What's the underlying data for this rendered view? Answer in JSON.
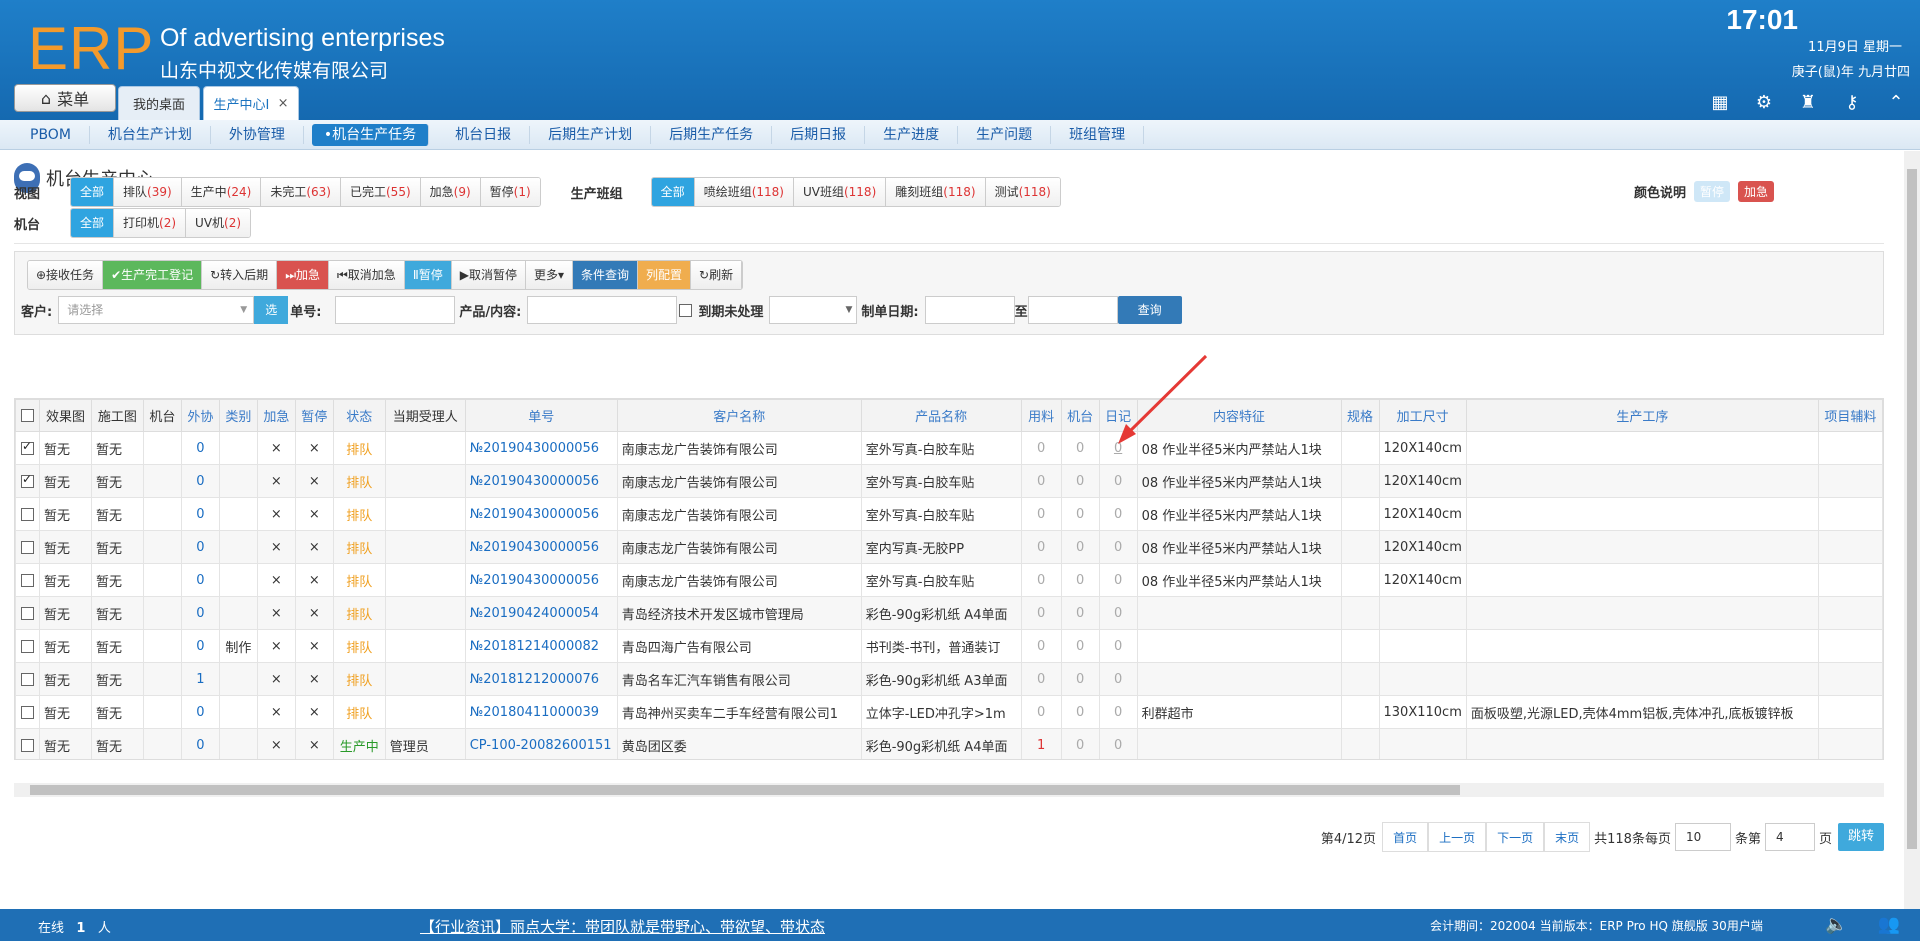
{
  "header": {
    "logo": "ERP",
    "company_en": "Of advertising enterprises",
    "company_cn": "山东中视文化传媒有限公司",
    "time": "17:01",
    "date": "11月9日 星期一",
    "lunar": "庚子(鼠)年 九月廿四",
    "menu_label": "菜单",
    "tabs": [
      {
        "label": "我的桌面"
      },
      {
        "label": "生产中心Ⅰ"
      }
    ],
    "tab_close": "×"
  },
  "subnav": [
    "PBOM",
    "机台生产计划",
    "外协管理",
    "•机台生产任务",
    "机台日报",
    "后期生产计划",
    "后期生产任务",
    "后期日报",
    "生产进度",
    "生产问题",
    "班组管理"
  ],
  "page": {
    "title": "机台生产中心",
    "view_label": "视图",
    "team_label": "生产班组",
    "machine_label": "机台",
    "color_legend_label": "颜色说明",
    "legend_paused": "暂停",
    "legend_urgent": "加急"
  },
  "views": [
    {
      "label": "全部",
      "count": ""
    },
    {
      "label": "排队",
      "count": "(39)"
    },
    {
      "label": "生产中",
      "count": "(24)"
    },
    {
      "label": "未完工",
      "count": "(63)"
    },
    {
      "label": "已完工",
      "count": "(55)"
    },
    {
      "label": "加急",
      "count": "(9)"
    },
    {
      "label": "暂停",
      "count": "(1)"
    }
  ],
  "teams": [
    {
      "label": "全部",
      "count": ""
    },
    {
      "label": "喷绘班组",
      "count": "(118)"
    },
    {
      "label": "UV班组",
      "count": "(118)"
    },
    {
      "label": "雕刻班组",
      "count": "(118)"
    },
    {
      "label": "测试",
      "count": "(118)"
    }
  ],
  "machines": [
    {
      "label": "全部",
      "count": ""
    },
    {
      "label": "打印机",
      "count": "(2)"
    },
    {
      "label": "UV机",
      "count": "(2)"
    }
  ],
  "toolbar": [
    "⊕接收任务",
    "✔生产完工登记",
    "↻转入后期",
    "⏭加急",
    "⏮取消加急",
    "Ⅱ暂停",
    "▶取消暂停",
    "更多▾",
    "条件查询",
    "列配置",
    "↻刷新"
  ],
  "search": {
    "customer_label": "客户:",
    "customer_placeholder": "请选择",
    "select_btn": "选",
    "order_label": "单号:",
    "product_label": "产品/内容:",
    "due_label": "到期未处理",
    "date_label": "制单日期:",
    "to_label": "至",
    "query_btn": "查询"
  },
  "columns": [
    "效果图",
    "施工图",
    "机台",
    "外协",
    "类别",
    "加急",
    "暂停",
    "状态",
    "当期受理人",
    "单号",
    "客户名称",
    "产品名称",
    "用料",
    "机台",
    "日记",
    "内容特征",
    "规格",
    "加工尺寸",
    "生产工序",
    "项目辅料"
  ],
  "rows": [
    {
      "checked": true,
      "effect": "暂无",
      "construct": "暂无",
      "machine": "",
      "outsource": "0",
      "category": "",
      "urgent": "×",
      "paused": "×",
      "status": "排队",
      "assignee": "",
      "order": "№20190430000056",
      "customer": "南康志龙广告装饰有限公司",
      "product": "室外写真-白胶车贴",
      "material": "0",
      "mc": "0",
      "diary": "0",
      "feature": "08 作业半径5米内严禁站人1块",
      "spec": "",
      "size": "120X140cm",
      "process": "",
      "aux": ""
    },
    {
      "checked": true,
      "effect": "暂无",
      "construct": "暂无",
      "machine": "",
      "outsource": "0",
      "category": "",
      "urgent": "×",
      "paused": "×",
      "status": "排队",
      "assignee": "",
      "order": "№20190430000056",
      "customer": "南康志龙广告装饰有限公司",
      "product": "室外写真-白胶车贴",
      "material": "0",
      "mc": "0",
      "diary": "0",
      "feature": "08 作业半径5米内严禁站人1块",
      "spec": "",
      "size": "120X140cm",
      "process": "",
      "aux": ""
    },
    {
      "checked": false,
      "effect": "暂无",
      "construct": "暂无",
      "machine": "",
      "outsource": "0",
      "category": "",
      "urgent": "×",
      "paused": "×",
      "status": "排队",
      "assignee": "",
      "order": "№20190430000056",
      "customer": "南康志龙广告装饰有限公司",
      "product": "室外写真-白胶车贴",
      "material": "0",
      "mc": "0",
      "diary": "0",
      "feature": "08 作业半径5米内严禁站人1块",
      "spec": "",
      "size": "120X140cm",
      "process": "",
      "aux": ""
    },
    {
      "checked": false,
      "effect": "暂无",
      "construct": "暂无",
      "machine": "",
      "outsource": "0",
      "category": "",
      "urgent": "×",
      "paused": "×",
      "status": "排队",
      "assignee": "",
      "order": "№20190430000056",
      "customer": "南康志龙广告装饰有限公司",
      "product": "室内写真-无胶PP",
      "material": "0",
      "mc": "0",
      "diary": "0",
      "feature": "08 作业半径5米内严禁站人1块",
      "spec": "",
      "size": "120X140cm",
      "process": "",
      "aux": ""
    },
    {
      "checked": false,
      "effect": "暂无",
      "construct": "暂无",
      "machine": "",
      "outsource": "0",
      "category": "",
      "urgent": "×",
      "paused": "×",
      "status": "排队",
      "assignee": "",
      "order": "№20190430000056",
      "customer": "南康志龙广告装饰有限公司",
      "product": "室外写真-白胶车贴",
      "material": "0",
      "mc": "0",
      "diary": "0",
      "feature": "08 作业半径5米内严禁站人1块",
      "spec": "",
      "size": "120X140cm",
      "process": "",
      "aux": ""
    },
    {
      "checked": false,
      "effect": "暂无",
      "construct": "暂无",
      "machine": "",
      "outsource": "0",
      "category": "",
      "urgent": "×",
      "paused": "×",
      "status": "排队",
      "assignee": "",
      "order": "№20190424000054",
      "customer": "青岛经济技术开发区城市管理局",
      "product": "彩色-90g彩机纸 A4单面",
      "material": "0",
      "mc": "0",
      "diary": "0",
      "feature": "",
      "spec": "",
      "size": "",
      "process": "",
      "aux": ""
    },
    {
      "checked": false,
      "effect": "暂无",
      "construct": "暂无",
      "machine": "",
      "outsource": "0",
      "category": "制作",
      "urgent": "×",
      "paused": "×",
      "status": "排队",
      "assignee": "",
      "order": "№20181214000082",
      "customer": "青岛四海广告有限公司",
      "product": "书刊类-书刊，普通装订",
      "material": "0",
      "mc": "0",
      "diary": "0",
      "feature": "",
      "spec": "",
      "size": "",
      "process": "",
      "aux": ""
    },
    {
      "checked": false,
      "effect": "暂无",
      "construct": "暂无",
      "machine": "",
      "outsource": "1",
      "category": "",
      "urgent": "×",
      "paused": "×",
      "status": "排队",
      "assignee": "",
      "order": "№20181212000076",
      "customer": "青岛名车汇汽车销售有限公司",
      "product": "彩色-90g彩机纸 A3单面",
      "material": "0",
      "mc": "0",
      "diary": "0",
      "feature": "",
      "spec": "",
      "size": "",
      "process": "",
      "aux": ""
    },
    {
      "checked": false,
      "effect": "暂无",
      "construct": "暂无",
      "machine": "",
      "outsource": "0",
      "category": "",
      "urgent": "×",
      "paused": "×",
      "status": "排队",
      "assignee": "",
      "order": "№20180411000039",
      "customer": "青岛神州买卖车二手车经营有限公司1",
      "product": "立体字-LED冲孔字>1m",
      "material": "0",
      "mc": "0",
      "diary": "0",
      "feature": "利群超市",
      "spec": "",
      "size": "130X110cm",
      "process": "面板吸塑,光源LED,壳体4mm铝板,壳体冲孔,底板镀锌板",
      "aux": ""
    },
    {
      "checked": false,
      "effect": "暂无",
      "construct": "暂无",
      "machine": "",
      "outsource": "0",
      "category": "",
      "urgent": "×",
      "paused": "×",
      "status": "生产中",
      "assignee": "管理员",
      "order": "CP-100-20082600151",
      "customer": "黄岛团区委",
      "product": "彩色-90g彩机纸 A4单面",
      "material": "1",
      "mc": "0",
      "diary": "0",
      "feature": "",
      "spec": "",
      "size": "",
      "process": "",
      "aux": ""
    }
  ],
  "pager": {
    "page_info": "第4/12页",
    "first": "首页",
    "prev": "上一页",
    "next": "下一页",
    "last": "末页",
    "total": "共118条每页",
    "per_page": "10",
    "item_label": "条第",
    "page_input": "4",
    "page_suffix": "页",
    "jump": "跳转"
  },
  "footer": {
    "online_label": "在线",
    "online_count": "1",
    "online_unit": "人",
    "news": "【行业资讯】丽点大学：带团队就是带野心、带欲望、带状态",
    "period": "会计期间：202004 当前版本：ERP Pro HQ 旗舰版 30用户端"
  },
  "colors": {
    "header": "#1f7fc9",
    "accent": "#2fa4e0",
    "logo": "#f39a2c",
    "status_queue": "#f0a020",
    "status_producing": "#2a9a2a"
  }
}
